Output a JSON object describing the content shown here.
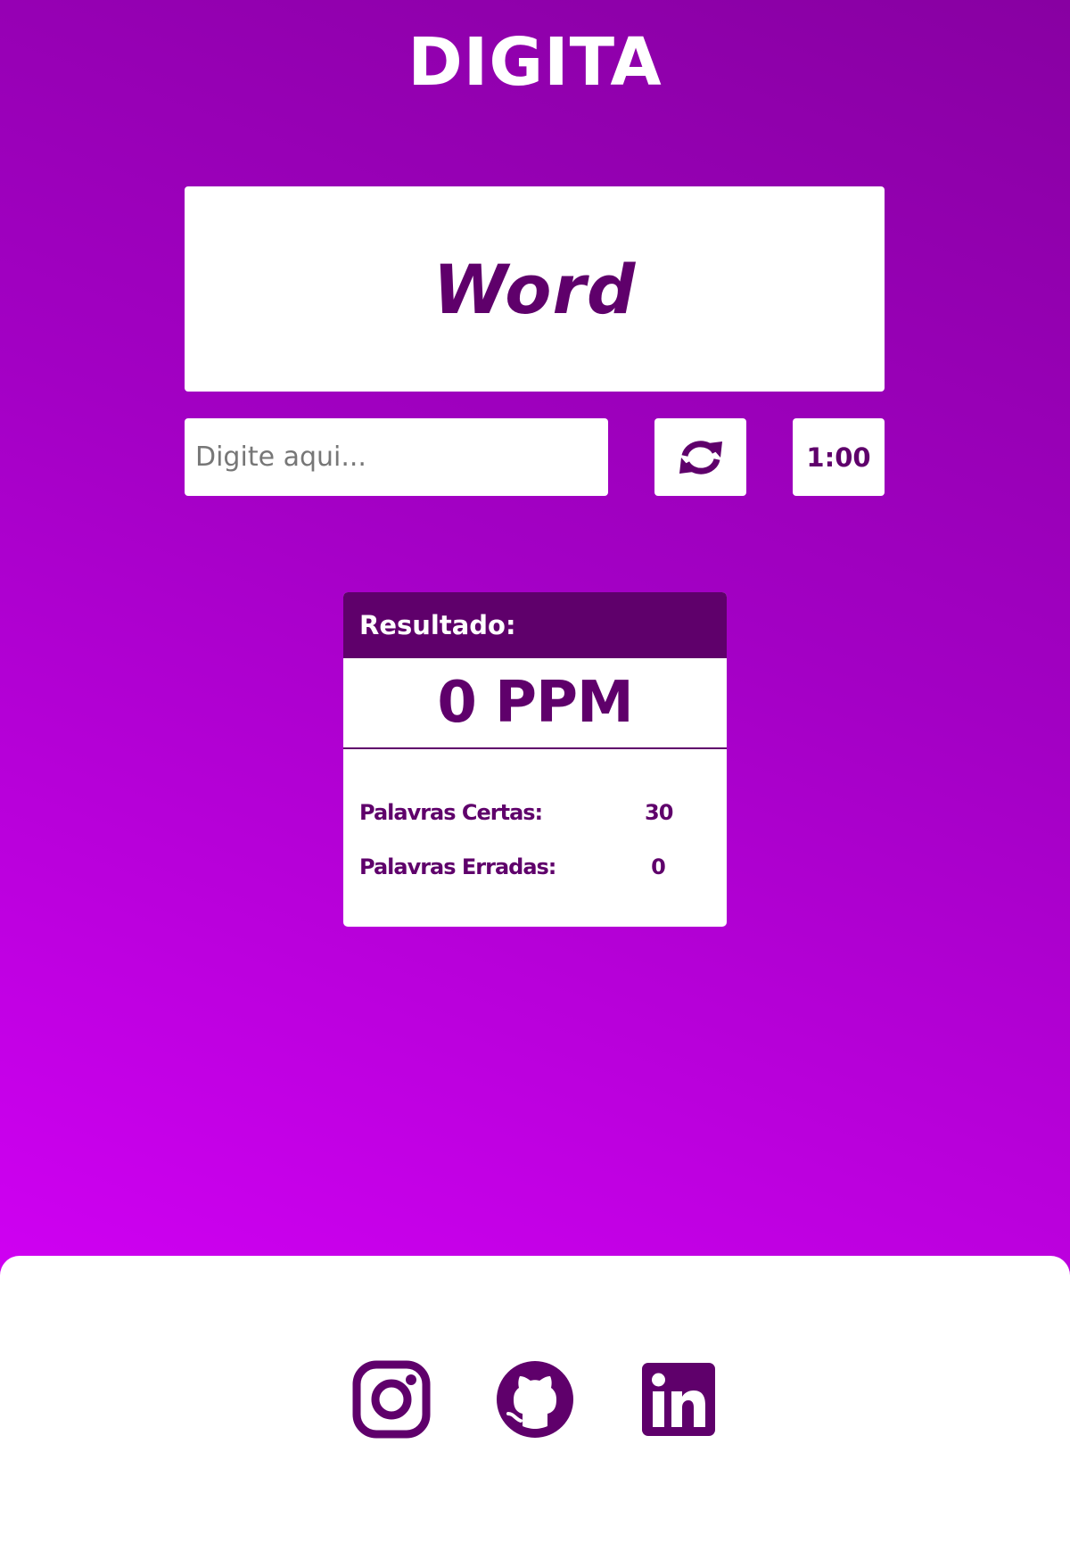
{
  "app": {
    "title": "DIGITA"
  },
  "game": {
    "current_word": "Word",
    "input_placeholder": "Digite aqui...",
    "input_value": "",
    "restart_icon": "sync-icon",
    "timer": "1:00"
  },
  "result": {
    "header": "Resultado:",
    "ppm": "0 PPM",
    "stats": [
      {
        "label": "Palavras Certas:",
        "value": "30"
      },
      {
        "label": "Palavras Erradas:",
        "value": "0"
      }
    ]
  },
  "footer": {
    "links": [
      {
        "icon": "instagram-icon"
      },
      {
        "icon": "github-icon"
      },
      {
        "icon": "linkedin-icon"
      }
    ]
  },
  "colors": {
    "brand_dark": "#5f006b",
    "gradient_top": "#8800a2",
    "gradient_bottom": "#cf00f2",
    "surface": "#ffffff"
  }
}
